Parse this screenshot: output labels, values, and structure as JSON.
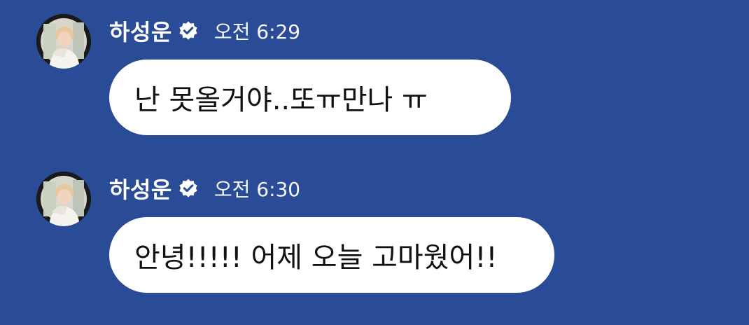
{
  "theme": {
    "background": "#2a4b95",
    "bubble": "#ffffff",
    "text": "#111111",
    "header_text": "#ffffff"
  },
  "messages": [
    {
      "sender": "하성운",
      "verified": true,
      "time": "오전 6:29",
      "text": "난 못올거야..또ㅠ만나 ㅠ",
      "avatar": "profile-photo"
    },
    {
      "sender": "하성운",
      "verified": true,
      "time": "오전 6:30",
      "text": "안녕!!!!! 어제 오늘 고마웠어!!",
      "avatar": "profile-photo"
    }
  ]
}
